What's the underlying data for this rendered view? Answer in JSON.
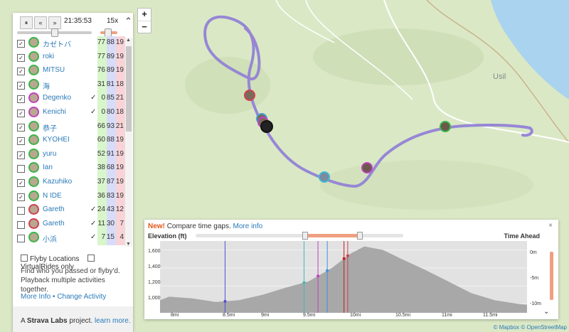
{
  "controls": {
    "pause_icon": "pause-icon",
    "prev_label": "«",
    "next_label": "»",
    "clock": "21:35:53",
    "speed": "15x",
    "collapse_icon": "chevron-up-icon"
  },
  "athletes": [
    {
      "checked": true,
      "name": "カゼトバ",
      "check": "",
      "v1": "77",
      "v2": "88",
      "v3": "19",
      "ring": "#39b54a"
    },
    {
      "checked": true,
      "name": "roki",
      "check": "",
      "v1": "77",
      "v2": "89",
      "v3": "19",
      "ring": "#39b54a"
    },
    {
      "checked": true,
      "name": "MITSU",
      "check": "",
      "v1": "76",
      "v2": "89",
      "v3": "19",
      "ring": "#39b54a"
    },
    {
      "checked": true,
      "name": "海",
      "check": "",
      "v1": "31",
      "v2": "81",
      "v3": "18",
      "ring": "#39b54a"
    },
    {
      "checked": true,
      "name": "Degenko",
      "check": "✓",
      "v1": "0",
      "v2": "85",
      "v3": "21",
      "ring": "#c040c0"
    },
    {
      "checked": true,
      "name": "Kenichi",
      "check": "✓",
      "v1": "0",
      "v2": "80",
      "v3": "18",
      "ring": "#c040c0"
    },
    {
      "checked": true,
      "name": "恭子",
      "check": "",
      "v1": "66",
      "v2": "93",
      "v3": "21",
      "ring": "#39b54a"
    },
    {
      "checked": true,
      "name": "KYOHEI",
      "check": "",
      "v1": "60",
      "v2": "88",
      "v3": "19",
      "ring": "#39b54a"
    },
    {
      "checked": true,
      "name": "yuru",
      "check": "",
      "v1": "52",
      "v2": "91",
      "v3": "19",
      "ring": "#39b54a"
    },
    {
      "checked": false,
      "name": "Ian",
      "check": "",
      "v1": "38",
      "v2": "68",
      "v3": "19",
      "ring": "#39b54a"
    },
    {
      "checked": true,
      "name": "Kazuhiko",
      "check": "",
      "v1": "37",
      "v2": "87",
      "v3": "19",
      "ring": "#39b54a"
    },
    {
      "checked": true,
      "name": "N IDE",
      "check": "",
      "v1": "36",
      "v2": "83",
      "v3": "19",
      "ring": "#39b54a"
    },
    {
      "checked": false,
      "name": "Gareth",
      "check": "✓",
      "v1": "24",
      "v2": "43",
      "v3": "12",
      "ring": "#d04050"
    },
    {
      "checked": false,
      "name": "Gareth",
      "check": "✓",
      "v1": "11",
      "v2": "30",
      "v3": "7",
      "ring": "#d04050"
    },
    {
      "checked": false,
      "name": "小浜",
      "check": "✓",
      "v1": "7",
      "v2": "15",
      "v3": "4",
      "ring": "#39b54a"
    }
  ],
  "options": {
    "flyby_locations": "Flyby Locations",
    "virtual_rides": "VirtualRides only"
  },
  "info_text": "Find who you passed or flyby'd. Playback multiple activities together.",
  "links": {
    "more_info": "More Info",
    "sep": "•",
    "change_activity": "Change Activity"
  },
  "footer": {
    "prefix": "A",
    "brand": "Strava Labs",
    "suffix": "project.",
    "learn_more": "learn more."
  },
  "zoom": {
    "in": "+",
    "out": "−"
  },
  "map": {
    "town_label": "Usil"
  },
  "elevation_panel": {
    "new_label": "New!",
    "announce": "Compare time gaps.",
    "more_info": "More info",
    "close": "×",
    "elevation_label": "Elevation (ft)",
    "time_ahead_label": "Time Ahead",
    "y_ticks": [
      "1,600",
      "1,400",
      "1,200",
      "1,000"
    ],
    "x_ticks": [
      "8mi",
      "8.5mi",
      "9mi",
      "9.5mi",
      "10mi",
      "10.5mi",
      "11mi",
      "11.5mi"
    ],
    "time_ticks": [
      "0m",
      "-5m",
      "-10m"
    ],
    "expand_icon": "chevron-down-icon"
  },
  "attribution": {
    "mapbox": "© Mapbox",
    "osm": "© OpenStreetMap"
  },
  "chart_data": {
    "type": "area",
    "xlabel": "",
    "ylabel": "Elevation (ft)",
    "x": [
      7.9,
      8.0,
      8.25,
      8.5,
      8.75,
      9.0,
      9.25,
      9.5,
      9.75,
      9.95,
      10.1,
      10.3,
      10.5,
      10.75,
      11.0,
      11.25,
      11.5,
      11.75,
      11.85
    ],
    "y": [
      1040,
      1080,
      1060,
      1020,
      1040,
      1100,
      1180,
      1250,
      1400,
      1560,
      1640,
      1600,
      1500,
      1380,
      1250,
      1120,
      1040,
      1000,
      990
    ],
    "ylim": [
      900,
      1700
    ],
    "xlim": [
      7.9,
      11.85
    ],
    "grid": true,
    "markers_x": [
      8.6,
      9.45,
      9.6,
      9.7,
      9.88,
      9.92
    ],
    "marker_colors": [
      "#5050d0",
      "#40b8b8",
      "#c040c0",
      "#4090e0",
      "#c02020",
      "#d04050"
    ]
  }
}
